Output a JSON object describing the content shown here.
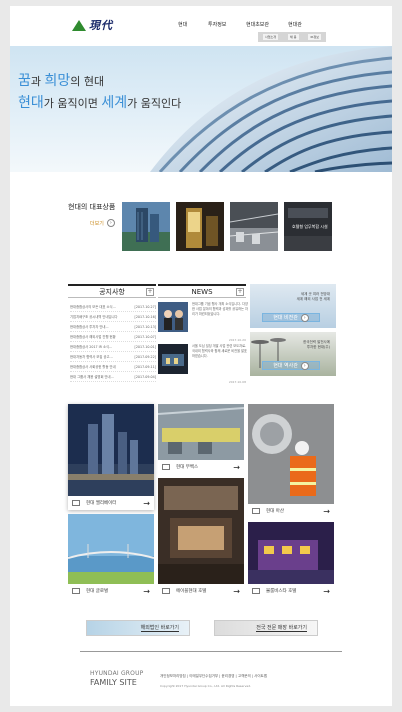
{
  "header": {
    "logo_text": "現代",
    "nav": [
      "현대",
      "투자정보",
      "현대초보관",
      "현대관"
    ],
    "subnav": [
      "사업소개",
      "채 용",
      "IR정보"
    ]
  },
  "hero": {
    "line1_a": "꿈",
    "line1_b": "과 ",
    "line1_c": "희망",
    "line1_d": "의 현대",
    "line2_a": "현대",
    "line2_b": "가 움직이면 ",
    "line2_c": "세계",
    "line2_d": "가 움직인다"
  },
  "products": {
    "title": "현대의 대표상품",
    "more": "더보기",
    "thumb_caption": "호텔형 업무복합 시설"
  },
  "notice": {
    "title": "공지사항",
    "rows": [
      {
        "text": "현대종합상사의 모든 대표 소식...",
        "date": "[2017.10.27]"
      },
      {
        "text": "기업지배구조 공시내역 안내입니다",
        "date": "[2017.10.16]"
      },
      {
        "text": "현대종합상사 투자자 안내...",
        "date": "[2017.10.13]"
      },
      {
        "text": "현대종합상사 해외사업 진행 현황",
        "date": "[2017.10.07]"
      },
      {
        "text": "현대종합상사 2017 IR 소식...",
        "date": "[2017.10.01]"
      },
      {
        "text": "현대자동차 협력사 모집 공고...",
        "date": "[2017.09.22]"
      },
      {
        "text": "현대종합상사 사회공헌 활동 안내",
        "date": "[2017.09.11]"
      },
      {
        "text": "현대 그룹사 채용 설명회 안내...",
        "date": "[2017.09.04]"
      }
    ]
  },
  "news": {
    "title": "NEWS",
    "items": [
      {
        "text": "현대그룹 기념 행사 개최 소식입니다. 다양한 사업 분야의 협력과 성과를 공유하는 자리가 마련되었습니다.",
        "date": "2017.10.20"
      },
      {
        "text": "서울 도심 빌딩 개발 사업 관련 보도자료. 국내외 협력사와 함께 새로운 비전을 발표하였습니다.",
        "date": "2017.10.08"
      }
    ]
  },
  "banners": [
    {
      "desc1": "세계 곳 여러 전망대",
      "desc2": "세계 해외 사업 전 세계",
      "button": "현대 비전관"
    },
    {
      "desc1": "한국전력 발전사에",
      "desc2": "투자한 현대(주)",
      "button": "현대 역사관"
    }
  ],
  "cards": [
    {
      "label": "현대 엘리베이터"
    },
    {
      "label": "현대 무벡스"
    },
    {
      "label": "현대 아산"
    },
    {
      "label": "현대 글로벌"
    },
    {
      "label": "에이블현대 호텔"
    },
    {
      "label": "불룸비스타 호텔"
    }
  ],
  "bottom_buttons": [
    {
      "label": "해외법인 바로가기"
    },
    {
      "label": "전국 전문 매장 바로가기"
    }
  ],
  "footer": {
    "family_line1": "HYUNDAI GROUP",
    "family_line2": "FAMILY SITE",
    "links": "개인정보처리방침 | 이메일무단수집거부 | 윤리경영 | 고객문의 | 사이트맵",
    "copyright": "Copyright 2017 Hyundai Group Co., Ltd. All Rights Reserved."
  },
  "colors": {
    "accent": "#3a8fd6",
    "logo_green": "#2f8b2f",
    "logo_navy": "#1d2c6b",
    "more_orange": "#c98a1d"
  }
}
